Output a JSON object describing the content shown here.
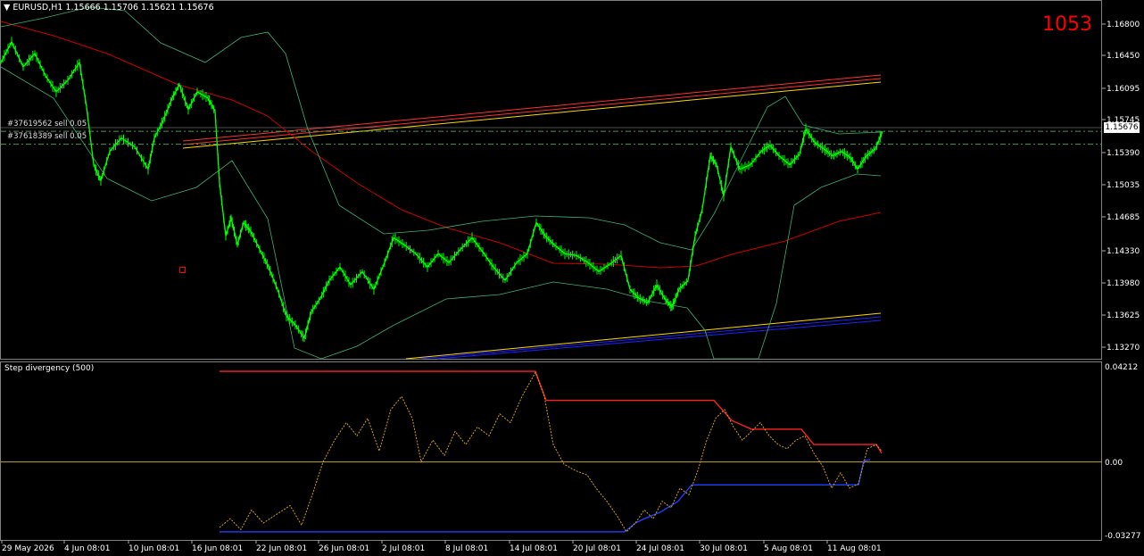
{
  "header": {
    "symbol_line": "EURUSD,H1  1.15666 1.15706 1.15621 1.15676",
    "counter": "1053"
  },
  "colors": {
    "background": "#000000",
    "price_line": "#00ff00",
    "bands": "#3cb371",
    "ma": "#cc0000",
    "channel_red": "#ff3030",
    "channel_yellow": "#ffd700",
    "channel_blue": "#2020ff",
    "order_line": "#4a9a4a",
    "divergency": "#d4a017",
    "step_upper": "#ff2020",
    "step_lower": "#2040ff",
    "zero_line": "#c8a040",
    "counter": "#ff0000",
    "axis_text": "#ffffff"
  },
  "orders": [
    {
      "label": "#37619562 sell 0.05",
      "price": 1.15676
    },
    {
      "label": "#37618389 sell 0.05",
      "price": 1.1553
    }
  ],
  "price_badge": "1.15676",
  "indicator": {
    "title": "Step divergency (500)",
    "y_ticks": [
      "0.04212",
      "0.00",
      "-0.03277"
    ]
  },
  "chart_data": {
    "type": "line",
    "title": "EURUSD,H1",
    "x_ticks": [
      "29 May 2026",
      "4 Jun 08:01",
      "10 Jun 08:01",
      "16 Jun 08:01",
      "22 Jun 08:01",
      "26 Jun 08:01",
      "2 Jul 08:01",
      "8 Jul 08:01",
      "14 Jul 08:01",
      "20 Jul 08:01",
      "24 Jul 08:01",
      "30 Jul 08:01",
      "5 Aug 08:01",
      "11 Aug 08:01"
    ],
    "y_ticks": [
      "1.16800",
      "1.16450",
      "1.16095",
      "1.15745",
      "1.15390",
      "1.15035",
      "1.14685",
      "1.14330",
      "1.13980",
      "1.13625",
      "1.13270"
    ],
    "ylim": [
      1.1312,
      1.1697
    ],
    "current_price": 1.15676,
    "price_series": [
      {
        "x": 0,
        "y": 1.1645
      },
      {
        "x": 12,
        "y": 1.1668
      },
      {
        "x": 25,
        "y": 1.164
      },
      {
        "x": 38,
        "y": 1.1655
      },
      {
        "x": 50,
        "y": 1.163
      },
      {
        "x": 62,
        "y": 1.1612
      },
      {
        "x": 75,
        "y": 1.1625
      },
      {
        "x": 88,
        "y": 1.1645
      },
      {
        "x": 96,
        "y": 1.1595
      },
      {
        "x": 104,
        "y": 1.153
      },
      {
        "x": 112,
        "y": 1.1512
      },
      {
        "x": 122,
        "y": 1.1545
      },
      {
        "x": 135,
        "y": 1.156
      },
      {
        "x": 150,
        "y": 1.155
      },
      {
        "x": 165,
        "y": 1.1525
      },
      {
        "x": 172,
        "y": 1.156
      },
      {
        "x": 182,
        "y": 1.158
      },
      {
        "x": 192,
        "y": 1.1605
      },
      {
        "x": 200,
        "y": 1.162
      },
      {
        "x": 210,
        "y": 1.1592
      },
      {
        "x": 220,
        "y": 1.1612
      },
      {
        "x": 232,
        "y": 1.1605
      },
      {
        "x": 240,
        "y": 1.159
      },
      {
        "x": 245,
        "y": 1.151
      },
      {
        "x": 252,
        "y": 1.145
      },
      {
        "x": 258,
        "y": 1.147
      },
      {
        "x": 265,
        "y": 1.144
      },
      {
        "x": 272,
        "y": 1.1465
      },
      {
        "x": 280,
        "y": 1.1455
      },
      {
        "x": 290,
        "y": 1.1435
      },
      {
        "x": 300,
        "y": 1.1415
      },
      {
        "x": 310,
        "y": 1.139
      },
      {
        "x": 320,
        "y": 1.136
      },
      {
        "x": 330,
        "y": 1.135
      },
      {
        "x": 340,
        "y": 1.1335
      },
      {
        "x": 348,
        "y": 1.1365
      },
      {
        "x": 358,
        "y": 1.138
      },
      {
        "x": 368,
        "y": 1.14
      },
      {
        "x": 380,
        "y": 1.1415
      },
      {
        "x": 392,
        "y": 1.1395
      },
      {
        "x": 405,
        "y": 1.141
      },
      {
        "x": 418,
        "y": 1.139
      },
      {
        "x": 430,
        "y": 1.142
      },
      {
        "x": 440,
        "y": 1.1448
      },
      {
        "x": 452,
        "y": 1.144
      },
      {
        "x": 465,
        "y": 1.143
      },
      {
        "x": 478,
        "y": 1.1415
      },
      {
        "x": 490,
        "y": 1.143
      },
      {
        "x": 502,
        "y": 1.142
      },
      {
        "x": 515,
        "y": 1.1435
      },
      {
        "x": 528,
        "y": 1.1448
      },
      {
        "x": 540,
        "y": 1.1432
      },
      {
        "x": 552,
        "y": 1.1415
      },
      {
        "x": 565,
        "y": 1.14
      },
      {
        "x": 578,
        "y": 1.142
      },
      {
        "x": 590,
        "y": 1.143
      },
      {
        "x": 600,
        "y": 1.1465
      },
      {
        "x": 610,
        "y": 1.145
      },
      {
        "x": 620,
        "y": 1.144
      },
      {
        "x": 632,
        "y": 1.143
      },
      {
        "x": 645,
        "y": 1.1428
      },
      {
        "x": 658,
        "y": 1.142
      },
      {
        "x": 670,
        "y": 1.141
      },
      {
        "x": 682,
        "y": 1.1418
      },
      {
        "x": 695,
        "y": 1.1428
      },
      {
        "x": 705,
        "y": 1.139
      },
      {
        "x": 715,
        "y": 1.138
      },
      {
        "x": 725,
        "y": 1.1375
      },
      {
        "x": 735,
        "y": 1.1395
      },
      {
        "x": 745,
        "y": 1.1378
      },
      {
        "x": 752,
        "y": 1.137
      },
      {
        "x": 760,
        "y": 1.139
      },
      {
        "x": 770,
        "y": 1.14
      },
      {
        "x": 778,
        "y": 1.145
      },
      {
        "x": 786,
        "y": 1.148
      },
      {
        "x": 795,
        "y": 1.154
      },
      {
        "x": 802,
        "y": 1.153
      },
      {
        "x": 810,
        "y": 1.1495
      },
      {
        "x": 818,
        "y": 1.155
      },
      {
        "x": 828,
        "y": 1.1525
      },
      {
        "x": 840,
        "y": 1.153
      },
      {
        "x": 852,
        "y": 1.1545
      },
      {
        "x": 862,
        "y": 1.1552
      },
      {
        "x": 872,
        "y": 1.154
      },
      {
        "x": 884,
        "y": 1.153
      },
      {
        "x": 895,
        "y": 1.1542
      },
      {
        "x": 902,
        "y": 1.157
      },
      {
        "x": 912,
        "y": 1.1555
      },
      {
        "x": 922,
        "y": 1.1548
      },
      {
        "x": 932,
        "y": 1.154
      },
      {
        "x": 942,
        "y": 1.1545
      },
      {
        "x": 952,
        "y": 1.1538
      },
      {
        "x": 960,
        "y": 1.1525
      },
      {
        "x": 970,
        "y": 1.154
      },
      {
        "x": 980,
        "y": 1.1548
      },
      {
        "x": 988,
        "y": 1.15676
      }
    ],
    "indicator_series": {
      "ylim": [
        -0.0345,
        0.044
      ],
      "divergency": [
        {
          "x": 246,
          "y": -0.03
        },
        {
          "x": 258,
          "y": -0.026
        },
        {
          "x": 270,
          "y": -0.031
        },
        {
          "x": 282,
          "y": -0.022
        },
        {
          "x": 295,
          "y": -0.028
        },
        {
          "x": 310,
          "y": -0.024
        },
        {
          "x": 325,
          "y": -0.02
        },
        {
          "x": 338,
          "y": -0.029
        },
        {
          "x": 350,
          "y": -0.015
        },
        {
          "x": 362,
          "y": 0.0
        },
        {
          "x": 375,
          "y": 0.01
        },
        {
          "x": 388,
          "y": 0.018
        },
        {
          "x": 400,
          "y": 0.012
        },
        {
          "x": 412,
          "y": 0.02
        },
        {
          "x": 425,
          "y": 0.005
        },
        {
          "x": 438,
          "y": 0.024
        },
        {
          "x": 450,
          "y": 0.03
        },
        {
          "x": 462,
          "y": 0.02
        },
        {
          "x": 472,
          "y": 0.0
        },
        {
          "x": 485,
          "y": 0.01
        },
        {
          "x": 498,
          "y": 0.003
        },
        {
          "x": 510,
          "y": 0.014
        },
        {
          "x": 522,
          "y": 0.008
        },
        {
          "x": 535,
          "y": 0.016
        },
        {
          "x": 548,
          "y": 0.012
        },
        {
          "x": 560,
          "y": 0.022
        },
        {
          "x": 572,
          "y": 0.018
        },
        {
          "x": 585,
          "y": 0.03
        },
        {
          "x": 600,
          "y": 0.041
        },
        {
          "x": 610,
          "y": 0.03
        },
        {
          "x": 620,
          "y": 0.008
        },
        {
          "x": 632,
          "y": -0.001
        },
        {
          "x": 645,
          "y": -0.004
        },
        {
          "x": 658,
          "y": -0.006
        },
        {
          "x": 668,
          "y": -0.012
        },
        {
          "x": 680,
          "y": -0.018
        },
        {
          "x": 692,
          "y": -0.025
        },
        {
          "x": 702,
          "y": -0.032
        },
        {
          "x": 712,
          "y": -0.028
        },
        {
          "x": 722,
          "y": -0.022
        },
        {
          "x": 732,
          "y": -0.026
        },
        {
          "x": 742,
          "y": -0.018
        },
        {
          "x": 752,
          "y": -0.021
        },
        {
          "x": 762,
          "y": -0.012
        },
        {
          "x": 772,
          "y": -0.015
        },
        {
          "x": 782,
          "y": -0.004
        },
        {
          "x": 792,
          "y": 0.01
        },
        {
          "x": 802,
          "y": 0.02
        },
        {
          "x": 812,
          "y": 0.024
        },
        {
          "x": 822,
          "y": 0.016
        },
        {
          "x": 832,
          "y": 0.01
        },
        {
          "x": 842,
          "y": 0.014
        },
        {
          "x": 852,
          "y": 0.018
        },
        {
          "x": 862,
          "y": 0.012
        },
        {
          "x": 872,
          "y": 0.008
        },
        {
          "x": 882,
          "y": 0.006
        },
        {
          "x": 892,
          "y": 0.01
        },
        {
          "x": 902,
          "y": 0.012
        },
        {
          "x": 912,
          "y": 0.004
        },
        {
          "x": 922,
          "y": -0.002
        },
        {
          "x": 932,
          "y": -0.012
        },
        {
          "x": 942,
          "y": -0.005
        },
        {
          "x": 952,
          "y": -0.012
        },
        {
          "x": 962,
          "y": -0.01
        },
        {
          "x": 972,
          "y": 0.006
        },
        {
          "x": 982,
          "y": 0.008
        },
        {
          "x": 988,
          "y": 0.005
        }
      ],
      "step_upper": [
        {
          "x": 246,
          "y": 0.0415
        },
        {
          "x": 600,
          "y": 0.0415
        },
        {
          "x": 612,
          "y": 0.0282
        },
        {
          "x": 800,
          "y": 0.0282
        },
        {
          "x": 820,
          "y": 0.019
        },
        {
          "x": 842,
          "y": 0.015
        },
        {
          "x": 898,
          "y": 0.015
        },
        {
          "x": 912,
          "y": 0.008
        },
        {
          "x": 982,
          "y": 0.008
        },
        {
          "x": 988,
          "y": 0.004
        }
      ],
      "step_lower": [
        {
          "x": 246,
          "y": -0.032
        },
        {
          "x": 700,
          "y": -0.032
        },
        {
          "x": 712,
          "y": -0.028
        },
        {
          "x": 722,
          "y": -0.026
        },
        {
          "x": 740,
          "y": -0.023
        },
        {
          "x": 760,
          "y": -0.018
        },
        {
          "x": 775,
          "y": -0.0105
        },
        {
          "x": 962,
          "y": -0.0105
        },
        {
          "x": 968,
          "y": 0.0005
        },
        {
          "x": 975,
          "y": 0.001
        }
      ]
    }
  }
}
